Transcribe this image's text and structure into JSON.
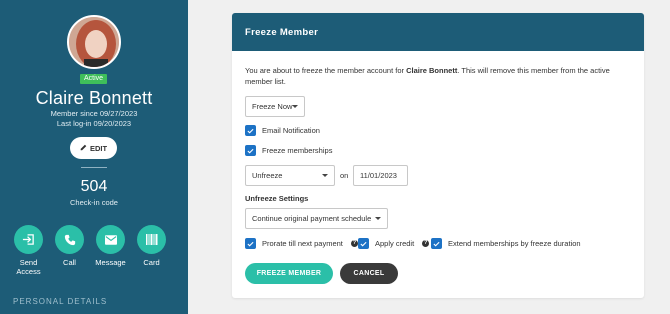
{
  "member": {
    "status": "Active",
    "name": "Claire Bonnett",
    "member_since": "Member since 09/27/2023",
    "last_login": "Last log-in 09/20/2023",
    "edit_label": "EDIT",
    "checkin_count": "504",
    "checkin_label": "Check-in code",
    "actions": [
      {
        "label": "Send\nAccess",
        "icon": "login-icon"
      },
      {
        "label": "Call",
        "icon": "phone-icon"
      },
      {
        "label": "Message",
        "icon": "mail-icon"
      },
      {
        "label": "Card",
        "icon": "barcode-icon"
      }
    ],
    "section_label": "PERSONAL DETAILS"
  },
  "modal": {
    "title": "Freeze Member",
    "intro_prefix": "You are about to freeze the member account for ",
    "intro_name": "Claire Bonnett",
    "intro_suffix": ". This will remove this member from the active member list.",
    "freeze_mode": "Freeze Now",
    "email_notification": "Email Notification",
    "freeze_memberships": "Freeze memberships",
    "unfreeze_mode": "Unfreeze",
    "on_label": "on",
    "unfreeze_date": "11/01/2023",
    "unfreeze_settings_label": "Unfreeze Settings",
    "payment_option": "Continue original payment schedule",
    "prorate_label": "Prorate till next payment",
    "apply_credit_label": "Apply credit",
    "extend_label": "Extend memberships by freeze duration",
    "primary_button": "FREEZE MEMBER",
    "secondary_button": "CANCEL"
  },
  "colors": {
    "sidebar": "#1d5c77",
    "accent": "#2bbfa8",
    "checkbox": "#1d72c5",
    "active_badge": "#3fbf5a"
  }
}
